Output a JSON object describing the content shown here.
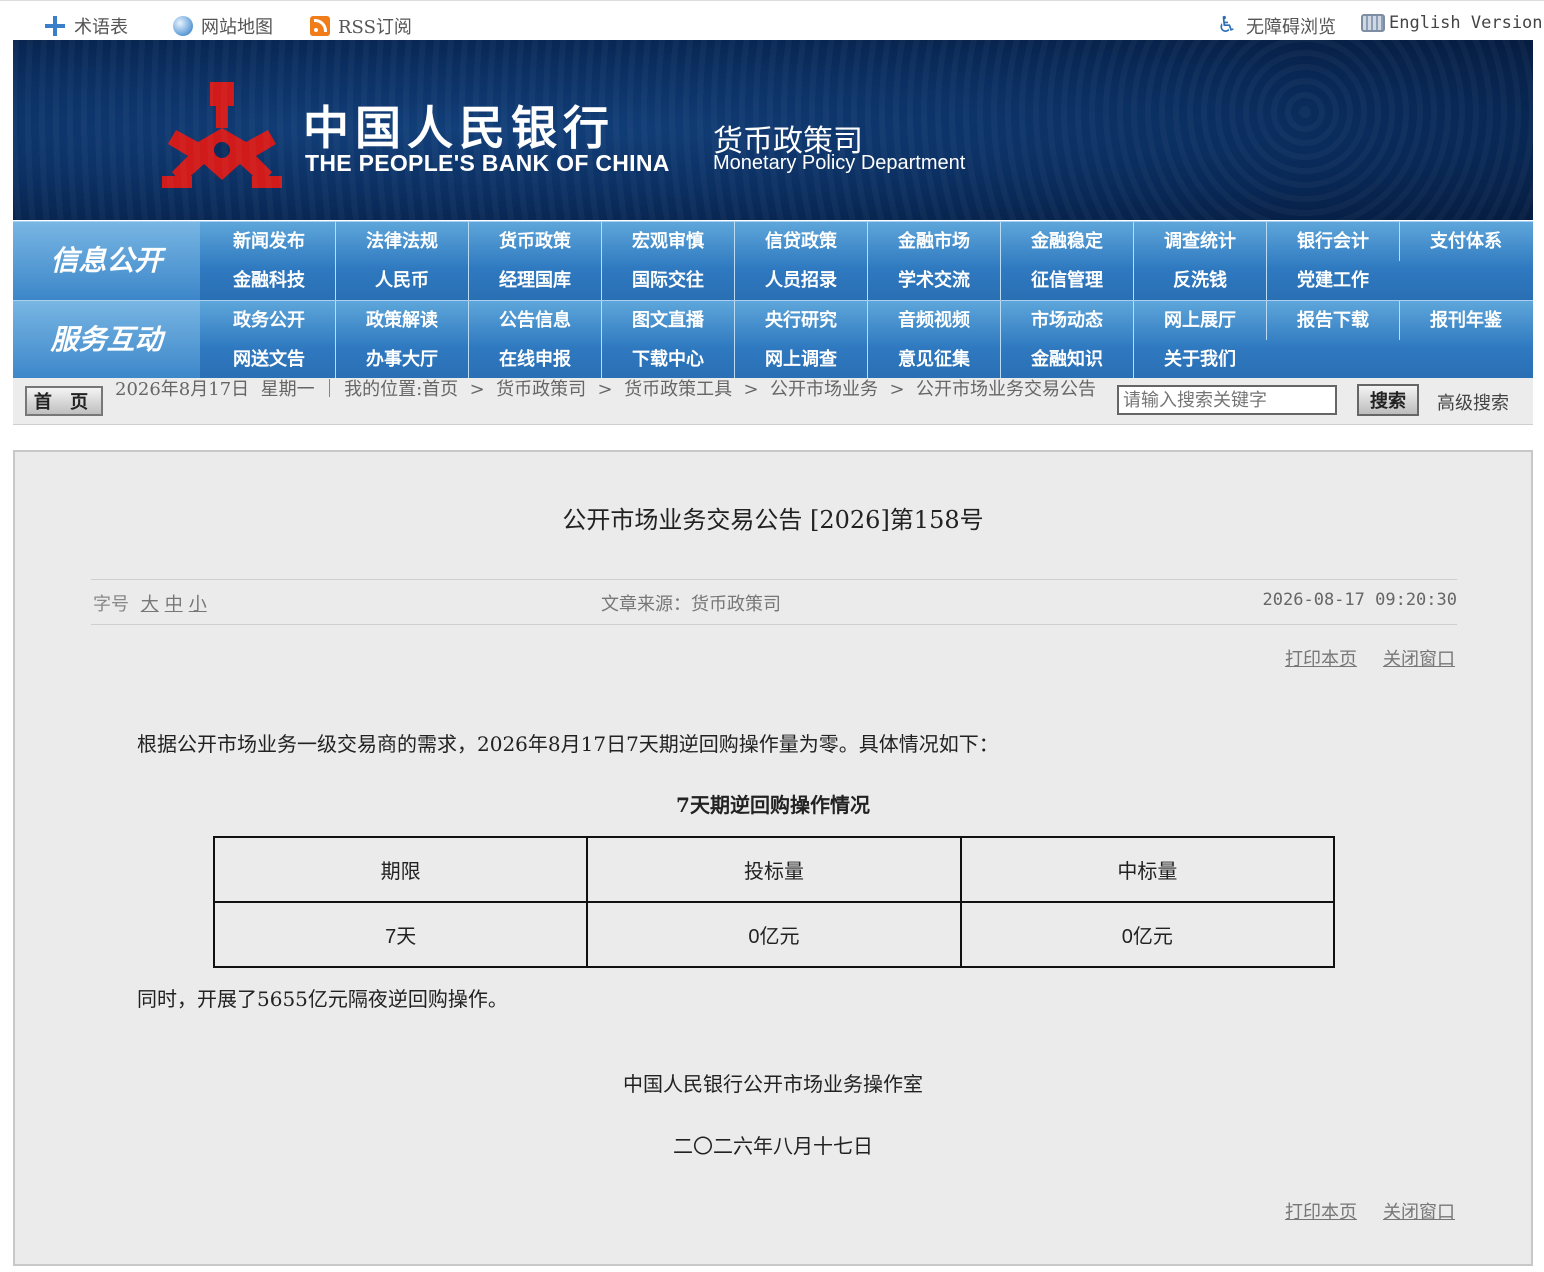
{
  "topbar": {
    "glossary": "术语表",
    "sitemap": "网站地图",
    "rss": "RSS订阅",
    "accessible": "无障碍浏览",
    "english": "English Version"
  },
  "banner": {
    "cn_title": "中国人民银行",
    "en_title": "THE PEOPLE'S BANK OF CHINA",
    "dept_cn": "货币政策司",
    "dept_en": "Monetary Policy Department"
  },
  "nav_info": {
    "label": "信息公开",
    "row1": [
      "新闻发布",
      "法律法规",
      "货币政策",
      "宏观审慎",
      "信贷政策",
      "金融市场",
      "金融稳定",
      "调查统计",
      "银行会计",
      "支付体系"
    ],
    "row2": [
      "金融科技",
      "人民币",
      "经理国库",
      "国际交往",
      "人员招录",
      "学术交流",
      "征信管理",
      "反洗钱",
      "党建工作"
    ]
  },
  "nav_service": {
    "label": "服务互动",
    "row1": [
      "政务公开",
      "政策解读",
      "公告信息",
      "图文直播",
      "央行研究",
      "音频视频",
      "市场动态",
      "网上展厅",
      "报告下载",
      "报刊年鉴"
    ],
    "row2": [
      "网送文告",
      "办事大厅",
      "在线申报",
      "下载中心",
      "网上调查",
      "意见征集",
      "金融知识",
      "关于我们"
    ]
  },
  "crumb": {
    "home": "首 页",
    "date": "2026年8月17日  星期一",
    "location": "我的位置:首页  >  货币政策司  >  货币政策工具  >  公开市场业务  >  公开市场业务交易公告",
    "search_placeholder": "请输入搜索关键字",
    "search_btn": "搜索",
    "advanced": "高级搜索"
  },
  "article": {
    "title": "公开市场业务交易公告 [2026]第158号",
    "font_label": "字号",
    "font_large": "大",
    "font_mid": "中",
    "font_small": "小",
    "source": "文章来源：货币政策司",
    "time": "2026-08-17 09:20:30",
    "print": "打印本页",
    "close": "关闭窗口",
    "para1": "根据公开市场业务一级交易商的需求，2026年8月17日7天期逆回购操作量为零。具体情况如下：",
    "table_title": "7天期逆回购操作情况",
    "table_headers": [
      "期限",
      "投标量",
      "中标量"
    ],
    "table_row": [
      "7天",
      "0亿元",
      "0亿元"
    ],
    "para2": "同时，开展了5655亿元隔夜逆回购操作。",
    "sign_org": "中国人民银行公开市场业务操作室",
    "sign_date": "二〇二六年八月十七日"
  }
}
